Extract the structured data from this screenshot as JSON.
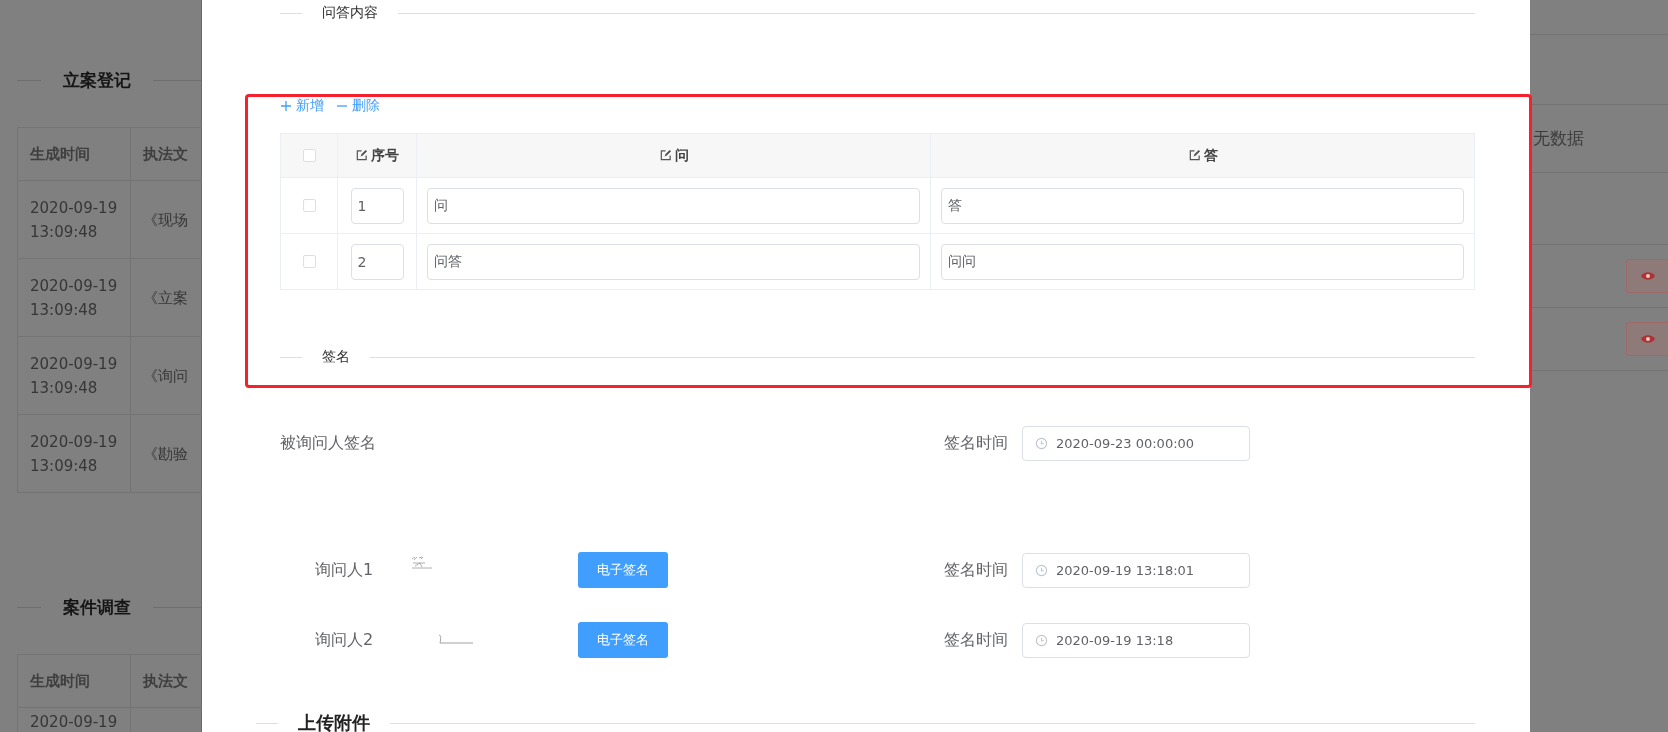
{
  "background_left": {
    "sections": [
      {
        "title": "立案登记",
        "columns": [
          "生成时间",
          "执法文"
        ],
        "rows": [
          [
            "2020-09-19 13:09:48",
            "《现场"
          ],
          [
            "2020-09-19 13:09:48",
            "《立案"
          ],
          [
            "2020-09-19 13:09:48",
            "《询问"
          ],
          [
            "2020-09-19 13:09:48",
            "《勘验"
          ]
        ]
      },
      {
        "title": "案件调查",
        "columns": [
          "生成时间",
          "执法文"
        ],
        "rows": [
          [
            "2020-09-19",
            ""
          ]
        ]
      }
    ]
  },
  "background_right": {
    "empty_text": "无数据",
    "view_buttons": [
      {
        "kind": "eye"
      },
      {
        "kind": "eye"
      }
    ]
  },
  "qa_section": {
    "title": "问答内容"
  },
  "toolbar": [
    {
      "kind": "add",
      "label": "新增"
    },
    {
      "kind": "remove",
      "label": "删除"
    }
  ],
  "qa_table": {
    "header_checked": false,
    "columns": [
      "序号",
      "问",
      "答"
    ],
    "rows": [
      {
        "checked": false,
        "index": "1",
        "question": "问",
        "answer": "答"
      },
      {
        "checked": false,
        "index": "2",
        "question": "问答",
        "answer": "问问"
      }
    ]
  },
  "sign_section": {
    "title": "签名"
  },
  "interviewee": {
    "label": "被询问人签名",
    "time_label": "签名时间",
    "time": "2020-09-23 00:00:00"
  },
  "interviewers": [
    {
      "label": "询问人1",
      "kind": "scribble",
      "button": "电子签名",
      "time_label": "签名时间",
      "time": "2020-09-19 13:18:01"
    },
    {
      "label": "询问人2",
      "kind": "stroke",
      "button": "电子签名",
      "time_label": "签名时间",
      "time": "2020-09-19 13:18"
    }
  ],
  "upload_section": {
    "title": "上传附件"
  }
}
